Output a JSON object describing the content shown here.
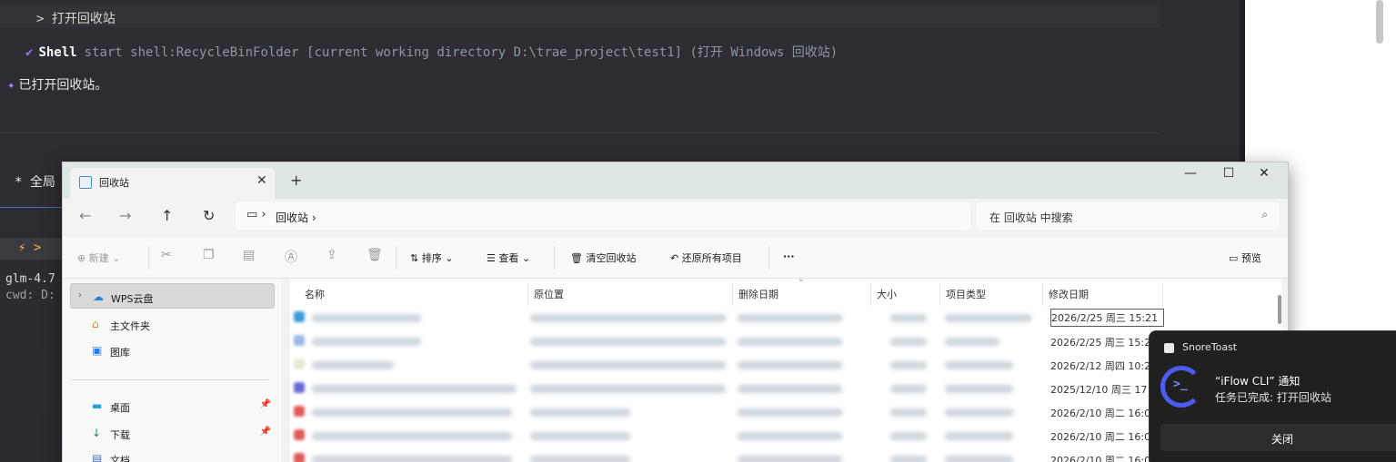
{
  "terminal": {
    "line_prompt": "> 打开回收站",
    "shell_label": "Shell",
    "shell_command": "start shell:RecycleBinFolder [current working directory D:\\trae_project\\test1] (打开 Windows 回收站)",
    "result_text": "已打开回收站。",
    "global_label": "* 全局",
    "tab_label": "⚡ >",
    "model": "glm-4.7",
    "cwd": "cwd: D:"
  },
  "explorer": {
    "tab_title": "回收站",
    "address_crumb": "回收站",
    "search_placeholder": "在 回收站 中搜索",
    "toolbar": {
      "new": "新建",
      "sort": "排序",
      "view": "查看",
      "empty": "清空回收站",
      "restore_all": "还原所有项目",
      "more": "···",
      "preview": "预览"
    },
    "sidebar": [
      {
        "label": "WPS云盘",
        "icon": "cloud-icon"
      },
      {
        "label": "主文件夹",
        "icon": "home-icon"
      },
      {
        "label": "图库",
        "icon": "gallery-icon"
      },
      {
        "label": "桌面",
        "icon": "desktop-icon"
      },
      {
        "label": "下载",
        "icon": "download-icon"
      },
      {
        "label": "文档",
        "icon": "document-icon"
      }
    ],
    "columns": [
      "名称",
      "原位置",
      "删除日期",
      "大小",
      "项目类型",
      "修改日期"
    ],
    "rows": [
      {
        "modified": "2026/2/25 周三 15:21"
      },
      {
        "modified": "2026/2/25 周三 15:2"
      },
      {
        "modified": "2026/2/12 周四 10:2"
      },
      {
        "modified": "2025/12/10 周三 17"
      },
      {
        "modified": "2026/2/10 周二 16:0"
      },
      {
        "modified": "2026/2/10 周二 16:0"
      },
      {
        "modified": "2026/2/10 周二 16:0"
      }
    ]
  },
  "toast": {
    "app": "SnoreToast",
    "title": "“iFlow CLI” 通知",
    "body": "任务已完成: 打开回收站",
    "button": "关闭"
  }
}
